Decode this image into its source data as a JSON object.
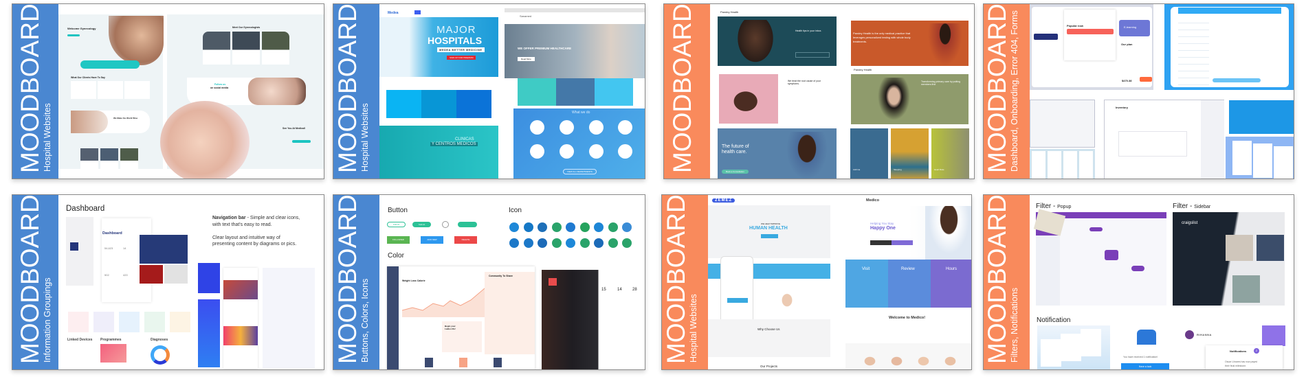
{
  "colors": {
    "blue": "#4a87d1",
    "orange": "#f98a5c"
  },
  "cards": [
    {
      "title": "MOODBOARD",
      "subtitle": "Hospital Websites",
      "texts": {
        "welcome": "Welcome Gynecology",
        "clients": "What Our Clients Have To Say",
        "world": "We Make the World Wise",
        "meet": "Meet Our Gynecologists",
        "follow1": "Follow us",
        "follow2": "on social media",
        "see": "See You At Medicall"
      }
    },
    {
      "title": "MOODBOARD",
      "subtitle": "Hospital Websites",
      "texts": {
        "logo": "Medea",
        "major": "MAJOR",
        "hospitals": "HOSPITALS",
        "tagline": "MEDEA BETTER MEDICINE",
        "cta": "SIGN UP FOR PREMIUM",
        "clinicas1": "CLINICAS",
        "clinicas2": "Y CENTROS MEDICOS",
        "logo2": "Sanamed",
        "premium": "WE OFFER PREMIUM HEALTHCARE",
        "read": "Read More",
        "whatwedo": "What we do",
        "viewall": "VIEW ALL DEPARTMENTS"
      }
    },
    {
      "title": "MOODBOARD",
      "subtitle": "",
      "texts": {
        "brand": "Pandey Health",
        "tips": "Health tips in your inbox.",
        "pandey": "Pandey Health is the only medical practice that leverages personalized testing with whole body treatments.",
        "root": "We treat the root cause of your symptoms.",
        "transform": "Transforming primary care by putting members first",
        "future1": "The future of",
        "future2": "health care.",
        "btn": "Book a Consultation",
        "asthma": "Asthma",
        "heart": "Heart Rate",
        "sleep": "Sleeping"
      }
    },
    {
      "title": "MOODBOARD",
      "subtitle": "Dashboard, Onboarding, Error 404, Forms",
      "texts": {
        "popular": "Popular now",
        "learning": "E-learning",
        "ourplan": "Our plan",
        "price": "$470.38",
        "inventory": "Inventory"
      }
    },
    {
      "title": "MOODBOARD",
      "subtitle": "Information Groupings",
      "texts": {
        "dashboard": "Dashboard",
        "nav_bold": "Navigation bar",
        "nav_rest": " - Simple and clear icons,",
        "nav_line2": "with text that's easy to read.",
        "clear1": "Clear layout and intuitive way of",
        "clear2": "presenting content by diagrams or pics.",
        "dash_word": "Dashboard",
        "n1": "54,623",
        "n2": "14",
        "n3": "502",
        "n4": "420",
        "linked": "Linked Devices",
        "programmes": "Programmes",
        "diagnoses": "Diagnoses"
      }
    },
    {
      "title": "MOODBOARD",
      "subtitle": "Buttons, Colors, Icons",
      "texts": {
        "button": "Button",
        "icon": "Icon",
        "color": "Color",
        "submit": "Submit",
        "follow": "FOLLOWED",
        "addnew": "ADD NEW",
        "delete": "DELETE",
        "community": "Community To Share",
        "weight": "Weight Loss Calorie",
        "begin": "Begin your Ladies life!",
        "s1": "15",
        "s2": "14",
        "s3": "28"
      }
    },
    {
      "title": "MOODBOARD",
      "subtitle": "Hospital Websites",
      "texts": {
        "zemez": "ZEMEZ",
        "help": "WE HELP IMPROVE",
        "human": "HUMAN HEALTH",
        "why": "Why Choose Us",
        "projects": "Our Projects",
        "medico": "Medico",
        "helping": "Helping You Stay",
        "happy": "Happy One",
        "visit": "Visit",
        "review": "Review",
        "hours": "Hours",
        "welcome": "Welcome to Medico!"
      }
    },
    {
      "title": "MOODBOARD",
      "subtitle": "Filters, Notifications",
      "texts": {
        "filter": "Filter",
        "popup": "Popup",
        "sidebar": "Sidebar",
        "dash": " - ",
        "notification": "Notification",
        "craigslist": "craigslist",
        "received": "You have received 1 notification!",
        "havelook": "Have a look",
        "rihanna": "RIHANNA",
        "notifs": "Notifications",
        "count": "2",
        "oscar1": "Oscar Llinares has now payed",
        "oscar2": "their final milestone."
      }
    }
  ]
}
